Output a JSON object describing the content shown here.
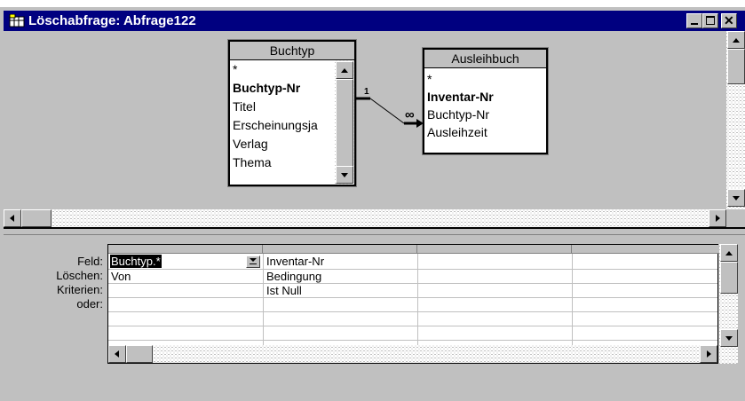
{
  "window": {
    "title": "Löschabfrage: Abfrage122",
    "title_bg": "#000080",
    "title_fg": "#ffffff",
    "buttons": {
      "minimize": "_",
      "maximize": "□",
      "close": "✕"
    }
  },
  "tables": [
    {
      "name": "Buchtyp",
      "fields": [
        "*",
        "Buchtyp-Nr",
        "Titel",
        "Erscheinungsja",
        "Verlag",
        "Thema"
      ],
      "bold_field": "Buchtyp-Nr"
    },
    {
      "name": "Ausleihbuch",
      "fields": [
        "*",
        "Inventar-Nr",
        "Buchtyp-Nr",
        "Ausleihzeit"
      ],
      "bold_field": "Inventar-Nr"
    }
  ],
  "relationship": {
    "one_label": "1",
    "many_label": "∞"
  },
  "grid": {
    "row_labels": [
      "Feld:",
      "Löschen:",
      "Kriterien:",
      "oder:"
    ],
    "columns": [
      {
        "feld": "Buchtyp.*",
        "loeschen": "Von",
        "kriterien": ""
      },
      {
        "feld": "Inventar-Nr",
        "loeschen": "Bedingung",
        "kriterien": "Ist Null"
      },
      {
        "feld": "",
        "loeschen": "",
        "kriterien": ""
      },
      {
        "feld": "",
        "loeschen": "",
        "kriterien": ""
      }
    ]
  }
}
